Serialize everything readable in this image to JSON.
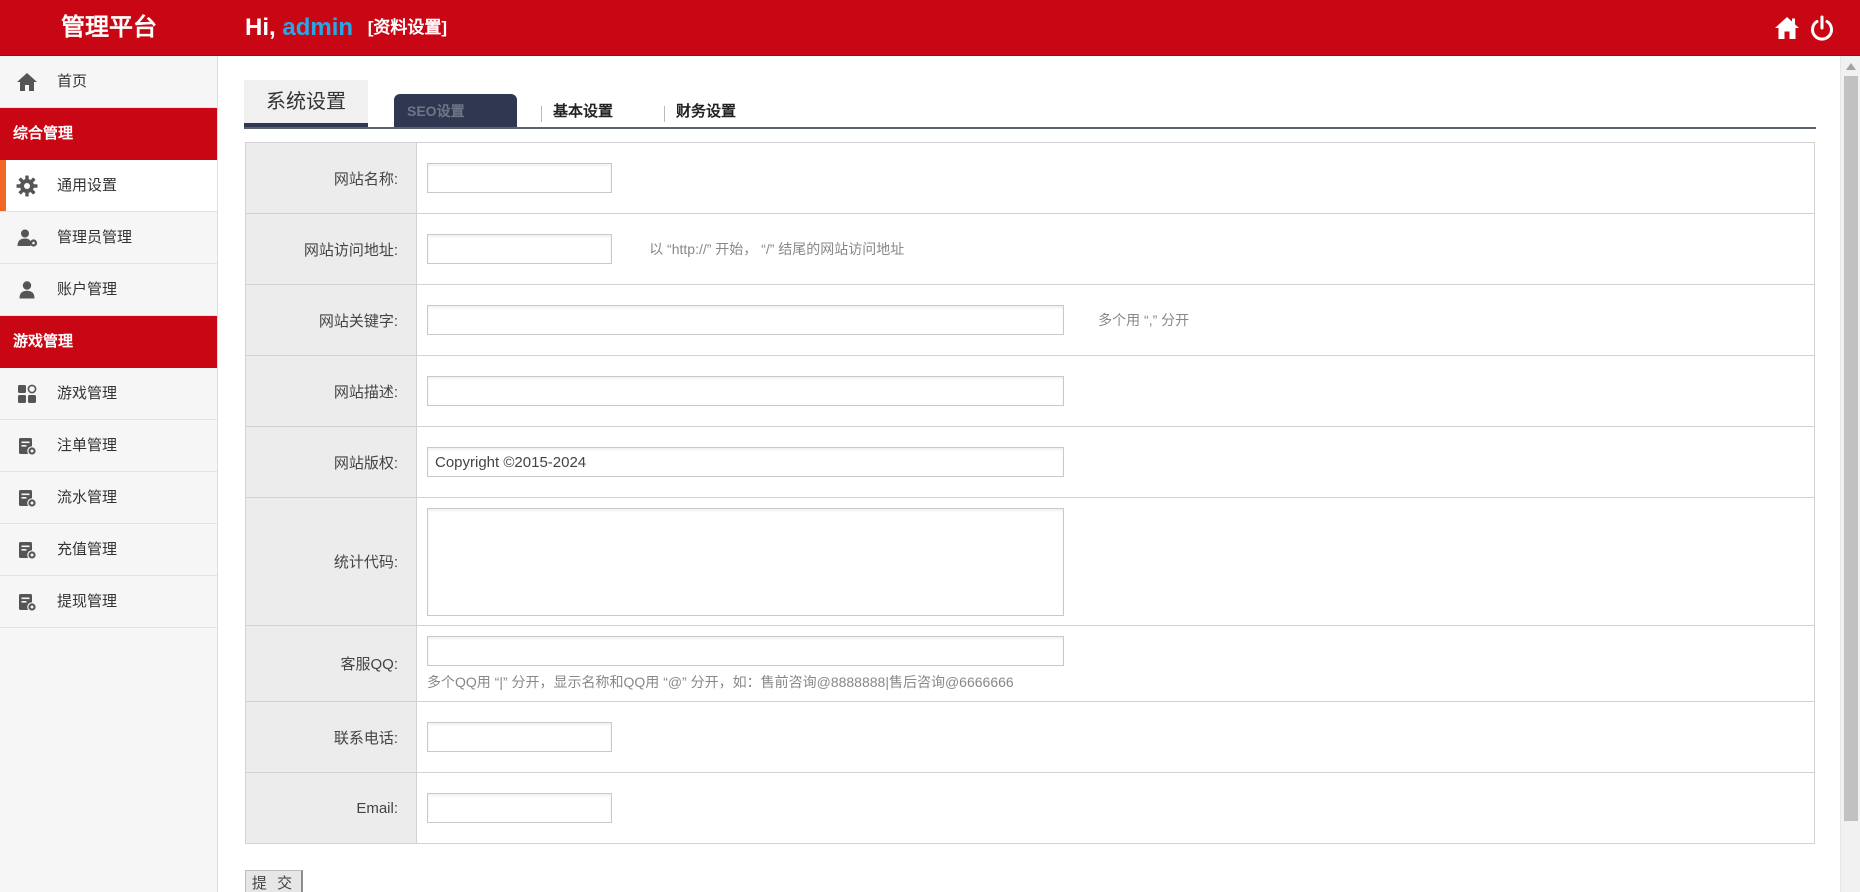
{
  "header": {
    "brand": "管理平台",
    "greeting": "Hi,",
    "username": "admin",
    "profile_link": "[资料设置]",
    "home_icon": "home-icon",
    "power_icon": "power-icon"
  },
  "sidebar": {
    "home": {
      "label": "首页",
      "icon": "home-icon"
    },
    "group1": "综合管理",
    "group1_items": [
      {
        "label": "通用设置",
        "icon": "gear-icon",
        "active": true
      },
      {
        "label": "管理员管理",
        "icon": "admin-user-icon"
      },
      {
        "label": "账户管理",
        "icon": "user-icon"
      }
    ],
    "group2": "游戏管理",
    "group2_items": [
      {
        "label": "游戏管理",
        "icon": "apps-icon"
      },
      {
        "label": "注单管理",
        "icon": "ledger-icon"
      },
      {
        "label": "流水管理",
        "icon": "ledger-icon"
      },
      {
        "label": "充值管理",
        "icon": "ledger-icon"
      },
      {
        "label": "提现管理",
        "icon": "ledger-icon"
      }
    ]
  },
  "tabs": {
    "main": "系统设置",
    "seo": "SEO设置",
    "basic": "基本设置",
    "finance": "财务设置"
  },
  "form": {
    "site_name": {
      "label": "网站名称:",
      "value": ""
    },
    "site_url": {
      "label": "网站访问地址:",
      "value": "",
      "hint": "以 “http://” 开始， “/” 结尾的网站访问地址"
    },
    "keywords": {
      "label": "网站关键字:",
      "value": "",
      "hint": "多个用 “,” 分开"
    },
    "description": {
      "label": "网站描述:",
      "value": ""
    },
    "copyright": {
      "label": "网站版权:",
      "value": "Copyright ©2015-2024"
    },
    "stats_code": {
      "label": "统计代码:",
      "value": ""
    },
    "qq": {
      "label": "客服QQ:",
      "value": "",
      "hint": "多个QQ用 “|” 分开，显示名称和QQ用 “@” 分开，如：售前咨询@8888888|售后咨询@6666666"
    },
    "phone": {
      "label": "联系电话:",
      "value": ""
    },
    "email": {
      "label": "Email:",
      "value": ""
    }
  },
  "submit_label": "提 交",
  "colors": {
    "brand_red": "#c90714",
    "username_blue": "#26a8e8",
    "tab_dark": "#2f3850",
    "active_marker": "#f26722"
  }
}
